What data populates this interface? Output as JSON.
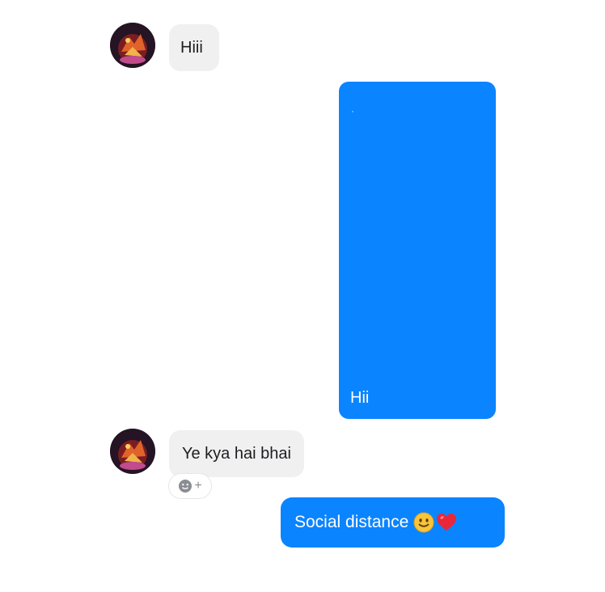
{
  "messages": [
    {
      "id": "m1",
      "direction": "incoming",
      "text": "Hiii"
    },
    {
      "id": "m2",
      "direction": "outgoing",
      "text": "Hii"
    },
    {
      "id": "m3",
      "direction": "incoming",
      "text": "Ye kya hai bhai"
    },
    {
      "id": "m4",
      "direction": "outgoing",
      "text": "Social distance",
      "emojis": [
        "slightly-smiling-face",
        "red-heart"
      ]
    }
  ],
  "reaction": {
    "plus_label": "+"
  },
  "colors": {
    "outgoing_bubble": "#0b84ff",
    "incoming_bubble": "#f1f0f0",
    "incoming_text": "#1c1e21",
    "outgoing_text": "#ffffff"
  }
}
